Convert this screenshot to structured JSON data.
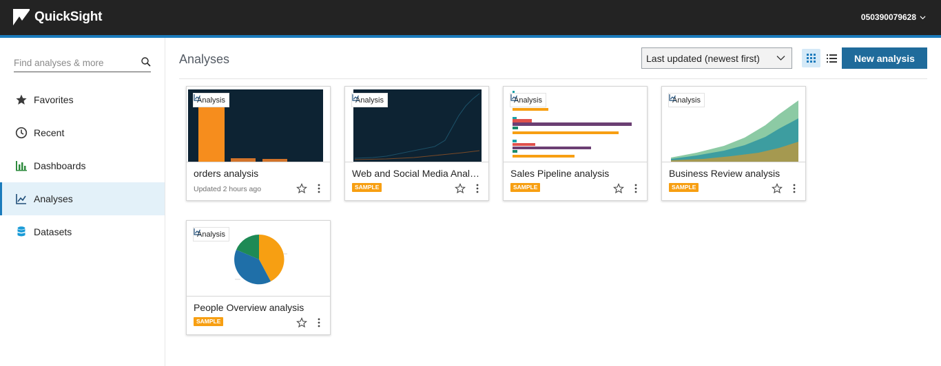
{
  "header": {
    "app_name": "QuickSight",
    "account_id": "050390079628"
  },
  "sidebar": {
    "search_placeholder": "Find analyses & more",
    "items": [
      {
        "label": "Favorites",
        "icon": "star-icon"
      },
      {
        "label": "Recent",
        "icon": "clock-icon"
      },
      {
        "label": "Dashboards",
        "icon": "dashboard-icon"
      },
      {
        "label": "Analyses",
        "icon": "analysis-icon",
        "active": true
      },
      {
        "label": "Datasets",
        "icon": "database-icon"
      }
    ]
  },
  "main": {
    "title": "Analyses",
    "sort_value": "Last updated (newest first)",
    "new_button": "New analysis",
    "view_mode": "grid"
  },
  "cards": [
    {
      "title": "orders analysis",
      "type": "Analysis",
      "meta": "Updated 2 hours ago"
    },
    {
      "title": "Web and Social Media Analytics analysis",
      "type": "Analysis",
      "badge": "SAMPLE"
    },
    {
      "title": "Sales Pipeline analysis",
      "type": "Analysis",
      "badge": "SAMPLE"
    },
    {
      "title": "Business Review analysis",
      "type": "Analysis",
      "badge": "SAMPLE"
    },
    {
      "title": "People Overview analysis",
      "type": "Analysis",
      "badge": "SAMPLE"
    }
  ],
  "colors": {
    "topbar": "#232323",
    "accent": "#1b7bbc",
    "primary_button": "#1f6b9b",
    "sample_badge": "#f79f12",
    "active_nav_bg": "#e3f1f9"
  }
}
